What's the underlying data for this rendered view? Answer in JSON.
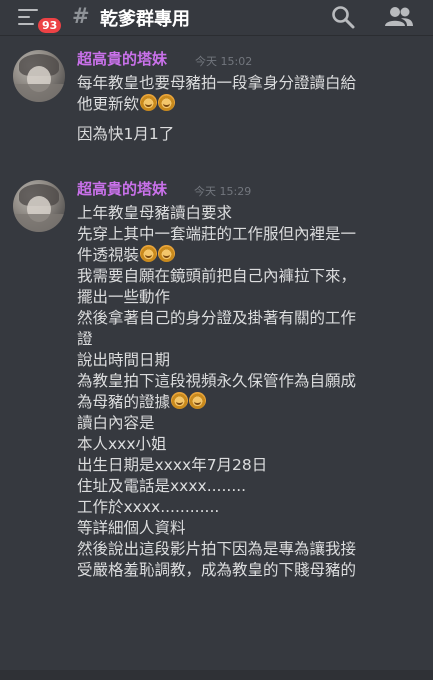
{
  "header": {
    "badge_count": "93",
    "channel_hash": "#",
    "channel_name": "乾爹群專用"
  },
  "messages": [
    {
      "author": "超高貴的塔妹",
      "time": "今天 15:02",
      "lines": [
        "每年教皇也要母豬拍一段拿身分證讀白給",
        "他更新欸",
        "因為快1月1了"
      ]
    },
    {
      "author": "超高貴的塔妹",
      "time": "今天 15:29",
      "lines": [
        "上年教皇母豬讀白要求",
        "先穿上其中一套端莊的工作服但內裡是一",
        "件透視裝",
        "我需要自願在鏡頭前把自己內褲拉下來，",
        "擺出一些動作",
        "然後拿著自己的身分證及掛著有關的工作",
        "證",
        "說出時間日期",
        "為教皇拍下這段視頻永久保管作為自願成",
        "為母豬的證據",
        "讀白內容是",
        "本人xxx小姐",
        "出生日期是xxxx年7月28日",
        "住址及電話是xxxx........",
        "工作於xxxx............",
        "等詳細個人資料",
        "然後說出這段影片拍下因為是專為讓我接",
        "受嚴格羞恥調教，成為教皇的下賤母豬的"
      ]
    }
  ],
  "icons": {
    "menu": "hamburger-menu-icon",
    "search": "search-icon",
    "members": "members-icon",
    "emoji": "facepalm-emoji-icon"
  },
  "colors": {
    "background": "#36393f",
    "author": "#c971ea",
    "badge": "#ed4245",
    "text": "#dcddde",
    "timestamp": "#72767d"
  }
}
